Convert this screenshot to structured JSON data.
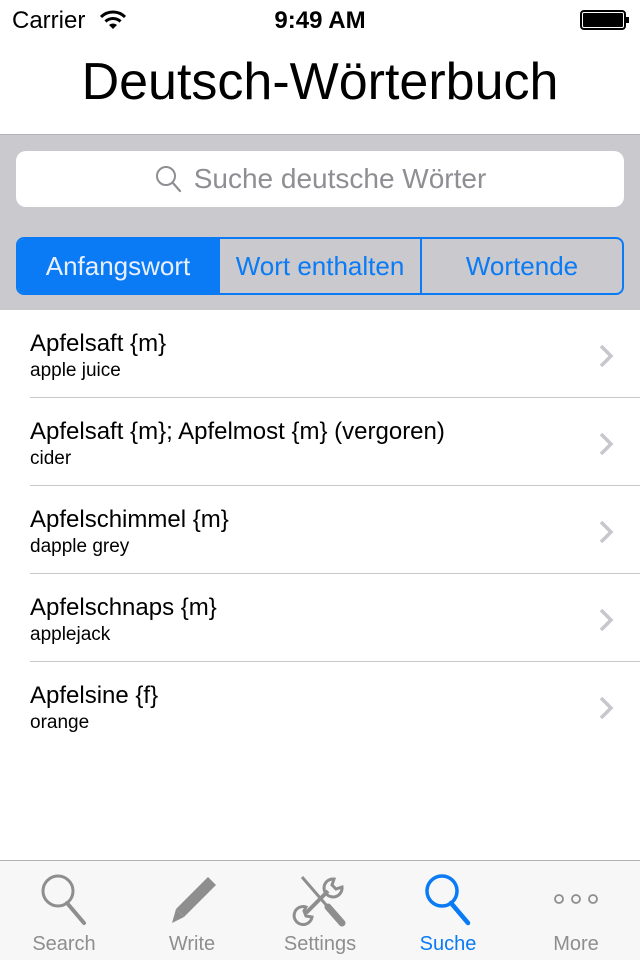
{
  "status_bar": {
    "carrier": "Carrier",
    "time": "9:49 AM"
  },
  "header": {
    "title": "Deutsch-Wörterbuch"
  },
  "search": {
    "placeholder": "Suche deutsche Wörter",
    "value": ""
  },
  "segments": {
    "items": [
      {
        "label": "Anfangswort",
        "selected": true
      },
      {
        "label": "Wort enthalten",
        "selected": false
      },
      {
        "label": "Wortende",
        "selected": false
      }
    ]
  },
  "results": [
    {
      "word": "Apfelsaft {m}",
      "translation": "apple juice"
    },
    {
      "word": "Apfelsaft {m}; Apfelmost {m} (vergoren)",
      "translation": "cider"
    },
    {
      "word": "Apfelschimmel {m}",
      "translation": "dapple grey"
    },
    {
      "word": "Apfelschnaps {m}",
      "translation": "applejack"
    },
    {
      "word": "Apfelsine {f}",
      "translation": "orange"
    }
  ],
  "tab_bar": {
    "items": [
      {
        "label": "Search",
        "icon": "magnifier-icon",
        "active": false
      },
      {
        "label": "Write",
        "icon": "pencil-icon",
        "active": false
      },
      {
        "label": "Settings",
        "icon": "tools-icon",
        "active": false
      },
      {
        "label": "Suche",
        "icon": "magnifier-icon",
        "active": true
      },
      {
        "label": "More",
        "icon": "more-dots-icon",
        "active": false
      }
    ]
  },
  "colors": {
    "accent": "#0a7bf5",
    "search_bar_bg": "#c9c9ce",
    "inactive_tab": "#8e8e8e"
  }
}
